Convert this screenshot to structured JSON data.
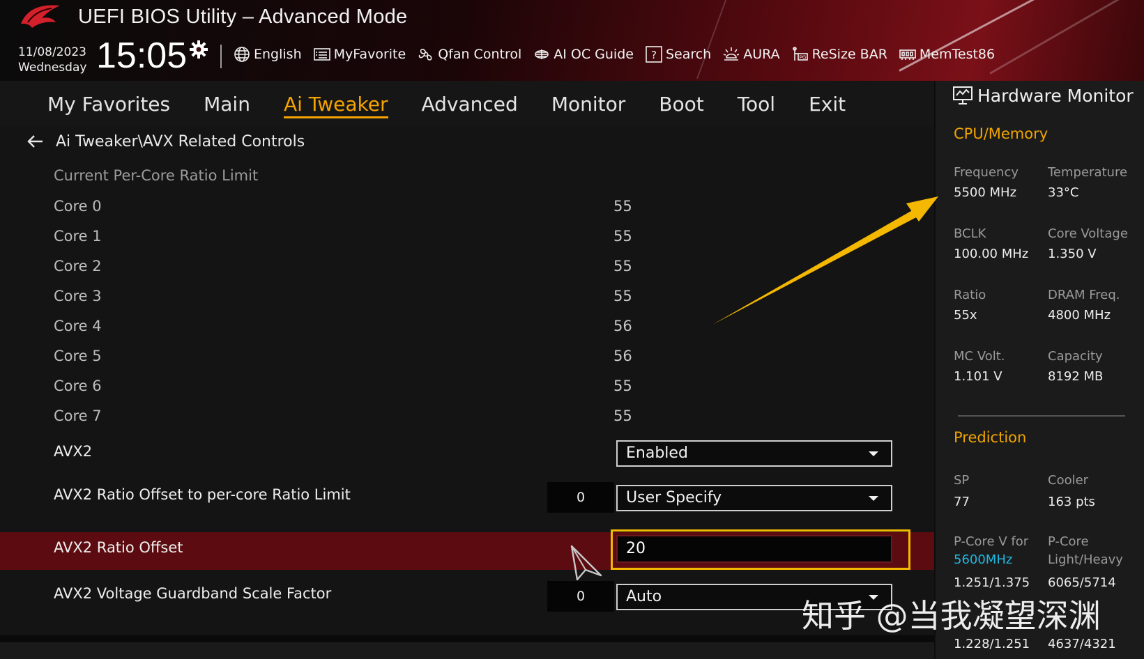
{
  "header": {
    "title": "UEFI BIOS Utility – Advanced Mode",
    "date": "11/08/2023",
    "weekday": "Wednesday",
    "time": "15:05",
    "toolbar": [
      {
        "label": "English",
        "icon": "globe-icon"
      },
      {
        "label": "MyFavorite",
        "icon": "favorite-list-icon"
      },
      {
        "label": "Qfan Control",
        "icon": "fan-icon"
      },
      {
        "label": "AI OC Guide",
        "icon": "ai-chip-icon"
      },
      {
        "label": "Search",
        "icon": "search-help-icon"
      },
      {
        "label": "AURA",
        "icon": "aura-light-icon"
      },
      {
        "label": "ReSize BAR",
        "icon": "resize-bar-icon"
      },
      {
        "label": "MemTest86",
        "icon": "memory-icon"
      }
    ]
  },
  "nav": {
    "tabs": [
      "My Favorites",
      "Main",
      "Ai Tweaker",
      "Advanced",
      "Monitor",
      "Boot",
      "Tool",
      "Exit"
    ],
    "active": "Ai Tweaker"
  },
  "main": {
    "breadcrumb": "Ai Tweaker\\AVX Related Controls",
    "section_label": "Current Per-Core Ratio Limit",
    "cores": [
      {
        "label": "Core 0",
        "value": "55"
      },
      {
        "label": "Core 1",
        "value": "55"
      },
      {
        "label": "Core 2",
        "value": "55"
      },
      {
        "label": "Core 3",
        "value": "55"
      },
      {
        "label": "Core 4",
        "value": "56"
      },
      {
        "label": "Core 5",
        "value": "56"
      },
      {
        "label": "Core 6",
        "value": "55"
      },
      {
        "label": "Core 7",
        "value": "55"
      }
    ],
    "settings": {
      "avx2": {
        "label": "AVX2",
        "value": "Enabled"
      },
      "avx2_offset_mode": {
        "label": "AVX2 Ratio Offset to per-core Ratio Limit",
        "current": "0",
        "value": "User Specify"
      },
      "avx2_offset": {
        "label": "AVX2 Ratio Offset",
        "value": "20"
      },
      "avx2_guardband": {
        "label": "AVX2 Voltage Guardband Scale Factor",
        "current": "0",
        "value": "Auto"
      }
    }
  },
  "hw_monitor": {
    "title": "Hardware Monitor",
    "cpu_memory": {
      "heading": "CPU/Memory",
      "items": [
        {
          "label": "Frequency",
          "value": "5500 MHz"
        },
        {
          "label": "Temperature",
          "value": "33°C"
        },
        {
          "label": "BCLK",
          "value": "100.00 MHz"
        },
        {
          "label": "Core Voltage",
          "value": "1.350 V"
        },
        {
          "label": "Ratio",
          "value": "55x"
        },
        {
          "label": "DRAM Freq.",
          "value": "4800 MHz"
        },
        {
          "label": "MC Volt.",
          "value": "1.101 V"
        },
        {
          "label": "Capacity",
          "value": "8192 MB"
        }
      ]
    },
    "prediction": {
      "heading": "Prediction",
      "sp_label": "SP",
      "sp_value": "77",
      "cooler_label": "Cooler",
      "cooler_value": "163 pts",
      "pcore_v_label": "P-Core V for",
      "pcore_v_freq": "5600MHz",
      "pcore_lh_label_1": "P-Core",
      "pcore_lh_label_2": "Light/Heavy",
      "pcore_v_value": "1.251/1.375",
      "pcore_lh_value": "6065/5714",
      "pcore_v_value_2": "1.228/1.251",
      "pcore_lh_value_2": "4637/4321"
    }
  },
  "watermark": "知乎 @当我凝望深渊",
  "colors": {
    "accent": "#f5a300",
    "highlight_row": "#5c0c10",
    "input_outline": "#f5b800",
    "link_blue": "#20b8e0"
  }
}
